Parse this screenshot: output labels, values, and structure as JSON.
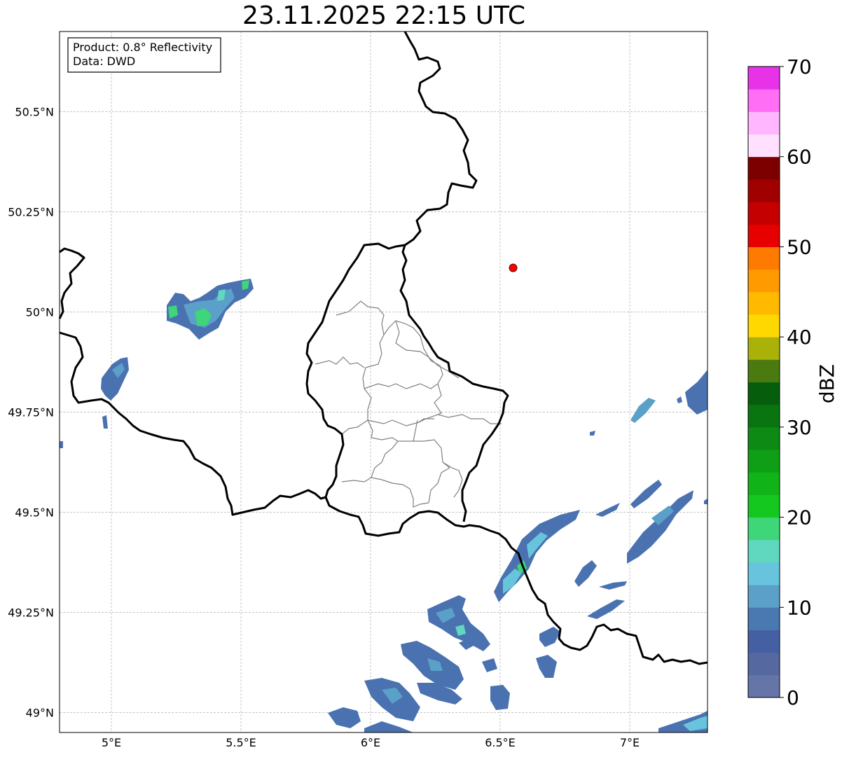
{
  "title": "23.11.2025 22:15 UTC",
  "info_box": {
    "line1": "Product: 0.8° Reflectivity",
    "line2": "Data: DWD"
  },
  "axes": {
    "lat_labels": [
      "50.5°N",
      "50.25°N",
      "50°N",
      "49.75°N",
      "49.5°N",
      "49.25°N",
      "49°N"
    ],
    "lon_labels": [
      "5°E",
      "5.5°E",
      "6°E",
      "6.5°E",
      "7°E"
    ],
    "lat_values": [
      50.5,
      50.25,
      50.0,
      49.75,
      49.5,
      49.25,
      49.0
    ],
    "lon_values": [
      5.0,
      5.5,
      6.0,
      6.5,
      7.0
    ],
    "lat_range": [
      48.95,
      50.7
    ],
    "lon_range": [
      4.8,
      7.3
    ],
    "grid": true
  },
  "marker": {
    "color": "#ff0000",
    "lon": 6.55,
    "lat": 50.11
  },
  "colorbar": {
    "unit": "dBZ",
    "tick_labels": [
      "0",
      "10",
      "20",
      "30",
      "40",
      "50",
      "60",
      "70"
    ],
    "min": 0,
    "max": 70,
    "colors": [
      "#6575a8",
      "#5568a0",
      "#4460a3",
      "#4a78b0",
      "#5aa0c8",
      "#68c4dc",
      "#60d8c0",
      "#3ed678",
      "#14c820",
      "#10b418",
      "#0f9f16",
      "#0c8a14",
      "#087510",
      "#065e0c",
      "#4a7a10",
      "#aab20a",
      "#ffd800",
      "#ffba00",
      "#ff9a00",
      "#ff7a00",
      "#e60000",
      "#c40000",
      "#a00000",
      "#7c0000",
      "#ffe0ff",
      "#ffb6ff",
      "#ff6ef4",
      "#e832e8"
    ]
  },
  "borders": {
    "national_color": "#000000",
    "district_color": "#808080"
  }
}
